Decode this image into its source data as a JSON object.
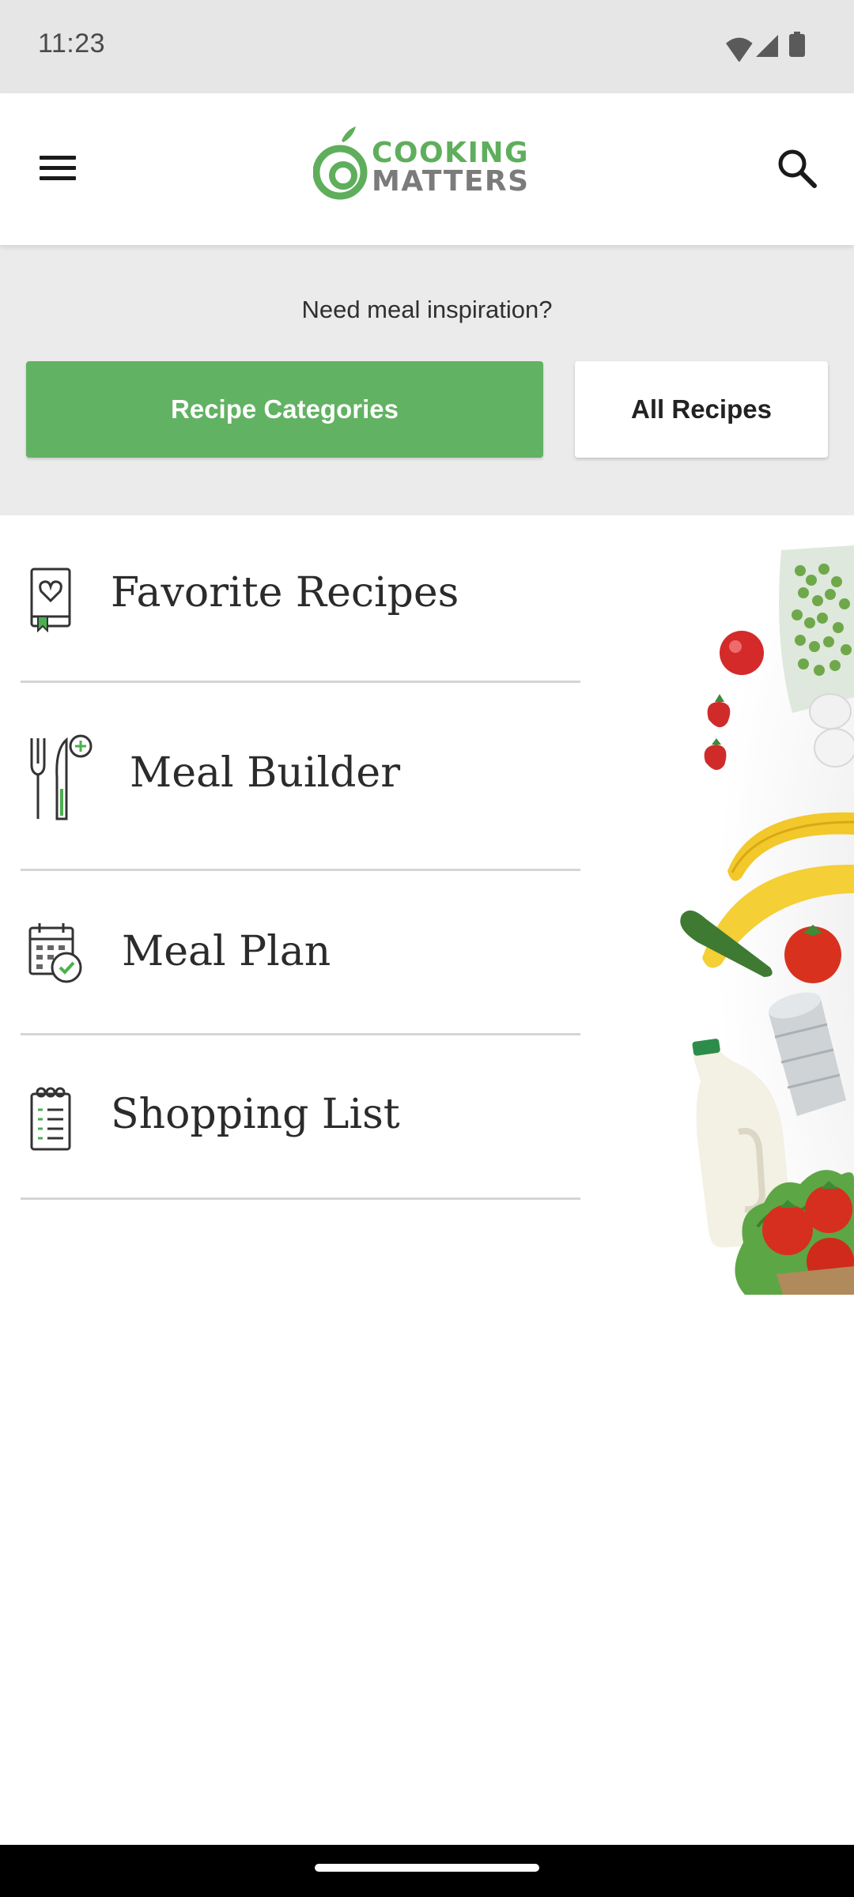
{
  "status_bar": {
    "time": "11:23",
    "icons": [
      "wifi-icon",
      "cellular-signal-icon",
      "battery-icon"
    ]
  },
  "app_bar": {
    "logo": {
      "line1": "COOKING",
      "line2": "MATTERS"
    },
    "menu_icon": "hamburger-menu-icon",
    "search_icon": "search-icon"
  },
  "inspiration": {
    "prompt": "Need meal inspiration?",
    "primary_button": "Recipe Categories",
    "secondary_button": "All Recipes"
  },
  "menu": {
    "items": [
      {
        "label": "Favorite Recipes",
        "icon": "recipe-book-heart-icon"
      },
      {
        "label": "Meal Builder",
        "icon": "fork-knife-plus-icon"
      },
      {
        "label": "Meal Plan",
        "icon": "calendar-check-icon"
      },
      {
        "label": "Shopping List",
        "icon": "notepad-list-icon"
      }
    ]
  },
  "colors": {
    "brand_green": "#62b263",
    "logo_gray": "#7b7b7b",
    "panel_bg": "#ebebeb",
    "status_bar_bg": "#e6e6e6"
  }
}
